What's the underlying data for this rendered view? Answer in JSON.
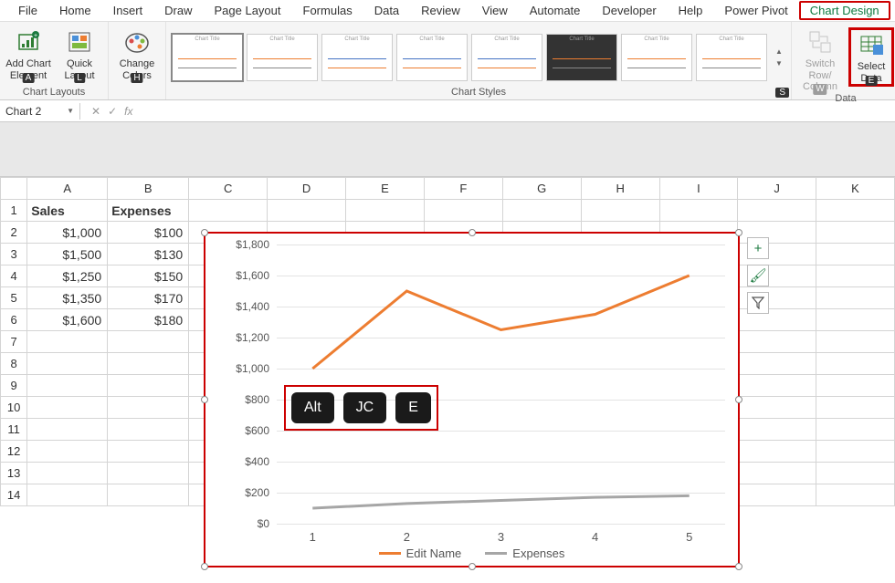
{
  "ribbon": {
    "tabs": [
      "File",
      "Home",
      "Insert",
      "Draw",
      "Page Layout",
      "Formulas",
      "Data",
      "Review",
      "View",
      "Automate",
      "Developer",
      "Help",
      "Power Pivot",
      "Chart Design"
    ],
    "groups": {
      "chart_layouts": {
        "label": "Chart Layouts",
        "add_element": "Add Chart Element",
        "quick_layout": "Quick Layout",
        "keytip_add": "A",
        "keytip_quick": "L"
      },
      "change_colors": {
        "label": "Change Colors",
        "keytip": "H"
      },
      "chart_styles": {
        "label": "Chart Styles",
        "keytip": "S",
        "thumb_title": "Chart Title"
      },
      "data": {
        "label": "Data",
        "switch": "Switch Row/ Column",
        "switch_keytip": "W",
        "select": "Select Data",
        "select_keytip": "E"
      }
    }
  },
  "formula_bar": {
    "name_box": "Chart 2",
    "fx": "fx"
  },
  "sheet": {
    "columns": [
      "A",
      "B",
      "C",
      "D",
      "E",
      "F",
      "G",
      "H",
      "I",
      "J",
      "K"
    ],
    "headers": {
      "A": "Sales",
      "B": "Expenses"
    },
    "rows": [
      {
        "A": "$1,000",
        "B": "$100"
      },
      {
        "A": "$1,500",
        "B": "$130"
      },
      {
        "A": "$1,250",
        "B": "$150"
      },
      {
        "A": "$1,350",
        "B": "$170"
      },
      {
        "A": "$1,600",
        "B": "$180"
      }
    ]
  },
  "chart_data": {
    "type": "line",
    "categories": [
      "1",
      "2",
      "3",
      "4",
      "5"
    ],
    "series": [
      {
        "name": "Edit Name",
        "color": "#ed7d31",
        "values": [
          1000,
          1500,
          1250,
          1350,
          1600
        ]
      },
      {
        "name": "Expenses",
        "color": "#a6a6a6",
        "values": [
          100,
          130,
          150,
          170,
          180
        ]
      }
    ],
    "ylabel": "",
    "xlabel": "",
    "ylim": [
      0,
      1800
    ],
    "ystep": 200,
    "ytick_prefix": "$"
  },
  "chart_side": {
    "elements": "+",
    "styles": "🖌",
    "filter": "⧩"
  },
  "key_seq": [
    "Alt",
    "JC",
    "E"
  ]
}
